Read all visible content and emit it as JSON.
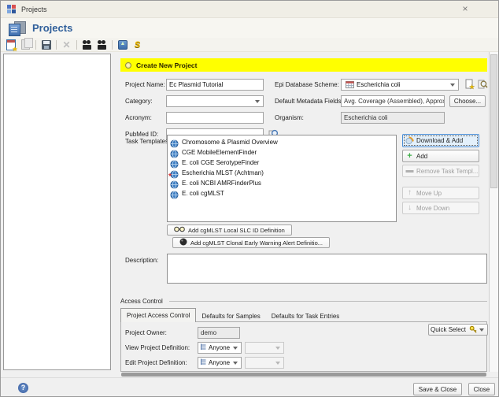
{
  "window": {
    "title": "Projects",
    "close_glyph": "×"
  },
  "header": {
    "title": "Projects"
  },
  "banner": {
    "title": "Create New Project"
  },
  "fields": {
    "project_name": {
      "label": "Project Name:",
      "value": "Ec Plasmid Tutorial"
    },
    "category": {
      "label": "Category:",
      "value": ""
    },
    "acronym": {
      "label": "Acronym:",
      "value": ""
    },
    "pubmed_id": {
      "label": "PubMed ID:",
      "value": ""
    },
    "epi_database_scheme": {
      "label": "Epi Database Scheme:",
      "value": "Escherichia coli"
    },
    "default_metadata_fields": {
      "label": "Default Metadata Fields:",
      "value": "Avg. Coverage (Assembled), Approximated Gen",
      "choose_button": "Choose..."
    },
    "organism": {
      "label": "Organism:",
      "value": "Escherichia coli"
    },
    "description": {
      "label": "Description:",
      "value": ""
    }
  },
  "task_templates": {
    "label": "Task Templates:",
    "items": [
      "Chromosome & Plasmid Overview",
      "CGE MobileElementFinder",
      "E. coli CGE SerotypeFinder",
      "Escherichia MLST (Achtman)",
      "E. coli NCBI AMRFinderPlus",
      "E. coli cgMLST"
    ],
    "buttons": {
      "download_add": "Download & Add",
      "add": "Add",
      "remove": "Remove Task Templ...",
      "move_up": "Move Up",
      "move_down": "Move Down",
      "add_slc": "Add cgMLST Local SLC ID Definition",
      "add_alert": "Add cgMLST Clonal Early Warning Alert Definitio..."
    }
  },
  "access_control": {
    "group_label": "Access Control",
    "tabs": [
      "Project Access Control",
      "Defaults for Samples",
      "Defaults for Task Entries"
    ],
    "quick_select_label": "Quick Select",
    "project_owner": {
      "label": "Project Owner:",
      "value": "demo"
    },
    "view_project_definition": {
      "label": "View Project Definition:",
      "value": "Anyone"
    },
    "edit_project_definition": {
      "label": "Edit Project Definition:",
      "value": "Anyone"
    }
  },
  "footer": {
    "save_close_button": "Save & Close",
    "close_button": "Close",
    "help_glyph": "?"
  },
  "colors": {
    "banner_bg": "#ffff00",
    "header_title": "#31609b",
    "focus_border": "#4b8ed6",
    "add_green": "#3fae49",
    "download_orange": "#f09d1e"
  }
}
